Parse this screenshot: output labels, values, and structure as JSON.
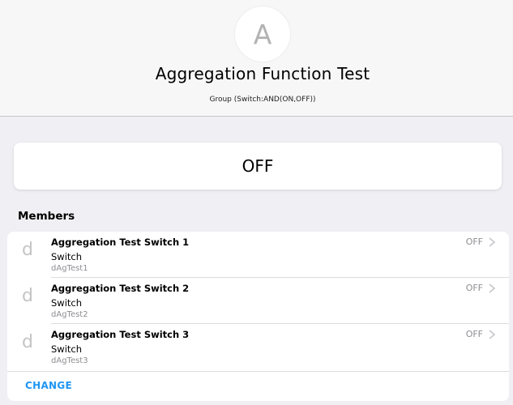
{
  "header": {
    "avatar_letter": "A",
    "title": "Aggregation Function Test",
    "subtitle": "Group (Switch:AND(ON,OFF))"
  },
  "state_card": {
    "state": "OFF"
  },
  "members_section": {
    "title": "Members",
    "change_label": "CHANGE",
    "items": [
      {
        "icon": "d",
        "name": "Aggregation Test Switch 1",
        "type": "Switch",
        "id": "dAgTest1",
        "state": "OFF"
      },
      {
        "icon": "d",
        "name": "Aggregation Test Switch 2",
        "type": "Switch",
        "id": "dAgTest2",
        "state": "OFF"
      },
      {
        "icon": "d",
        "name": "Aggregation Test Switch 3",
        "type": "Switch",
        "id": "dAgTest3",
        "state": "OFF"
      }
    ]
  },
  "colors": {
    "background": "#efeff4",
    "header_background": "#f7f7f7",
    "accent": "#2196f3",
    "secondary_text": "#8e8e93"
  }
}
